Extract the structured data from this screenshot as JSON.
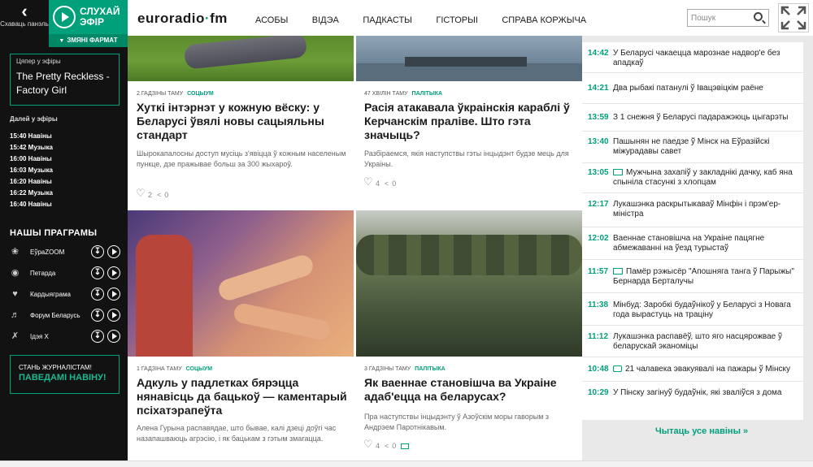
{
  "sidebar": {
    "collapse_label": "Схаваць панэль",
    "listen_label": "СЛУХАЙ ЭФІР",
    "change_format": "ЗМЯНІ ФАРМАТ",
    "now_label": "Цяпер у эфіры",
    "now_track": "The Pretty Reckless - Factory Girl",
    "next_label": "Далей у эфіры",
    "schedule": [
      "15:40 Навіны",
      "15:42 Музыка",
      "16:00 Навіны",
      "16:03 Музыка",
      "16:20 Навіны",
      "16:22 Музыка",
      "16:40 Навіны"
    ],
    "programs_title": "НАШЫ ПРАГРАМЫ",
    "programs": [
      {
        "name": "ЕўраZOOM",
        "icon": "globe-icon"
      },
      {
        "name": "Петарда",
        "icon": "circle-icon"
      },
      {
        "name": "Кардыяграма",
        "icon": "heart-icon"
      },
      {
        "name": "Форум Беларусь",
        "icon": "speaker-icon"
      },
      {
        "name": "Ідэя Х",
        "icon": "tools-icon"
      }
    ],
    "cta_line1": "СТАНЬ ЖУРНАЛІСТАМ!",
    "cta_line2": "ПАВЕДАМІ НАВІНУ!"
  },
  "header": {
    "logo_part1": "euroradio",
    "logo_part2": "fm",
    "nav": [
      "АСОБЫ",
      "ВІДЭА",
      "ПАДКАСТЫ",
      "ГІСТОРЫІ",
      "СПРАВА КОРЖЫЧА"
    ],
    "search_placeholder": "Пошук"
  },
  "articles": [
    {
      "time": "2 ГАДЗІНЫ ТАМУ",
      "category": "СОЦЫУМ",
      "title": "Хуткі інтэрнэт у кожную вёску: у Беларусі ўвялі новы сацыяльны стандарт",
      "lead": "Шырокапалосны доступ мусіць з'явіцца ў кожным населеным пункце, дзе пражывае больш за 300 жыхароў.",
      "likes": "2",
      "shares": "0"
    },
    {
      "time": "47 ХВІЛІН ТАМУ",
      "category": "ПАЛІТЫКА",
      "title": "Расія атакавала ўкраінскія караблі ў Керчанскім праліве. Што гэта значыць?",
      "lead": "Разбіраемся, якія наступствы гэты інцыдэнт будзе мець для Украіны.",
      "likes": "4",
      "shares": "0"
    },
    {
      "time": "1 ГАДЗІНА ТАМУ",
      "category": "СОЦЫУМ",
      "title": "Адкуль у падлетках бярэцца нянавісць да бацькоў — каментарый псіхатэрапеўта",
      "lead": "Алена Гурына распавядае, што бывае, калі дзеці доўгі час назапашваюць агрэсію, і як бацькам з гэтым змагацца.",
      "likes": "",
      "shares": ""
    },
    {
      "time": "3 ГАДЗІНЫ ТАМУ",
      "category": "ПАЛІТЫКА",
      "title": "Як ваеннае становішча ва Украіне адаб'ецца на беларусах?",
      "lead": "Пра наступствы інцыдэнту ў Азоўскім моры гаворым з Андрэем Паротнікавым.",
      "likes": "4",
      "shares": "0"
    }
  ],
  "feed": [
    {
      "time": "14:42",
      "text": "У Беларусі чакаецца марознае надвор'е без ападкаў",
      "icon": ""
    },
    {
      "time": "14:21",
      "text": "Два рыбакі патанулі ў Івацэвіцкім раёне",
      "icon": ""
    },
    {
      "time": "13:59",
      "text": "З 1 снежня ў Беларусі падаражэюць цыгарэты",
      "icon": ""
    },
    {
      "time": "13:40",
      "text": "Пашынян не паедзе ў Мінск на Еўразійскі міжурадавы савет",
      "icon": ""
    },
    {
      "time": "13:05",
      "text": "Мужчына захапіў у закладнікі дачку, каб яна спыніла стасункі з хлопцам",
      "icon": "video"
    },
    {
      "time": "12:17",
      "text": "Лукашэнка раскрытыкаваў Мінфін і прэм'ер-міністра",
      "icon": ""
    },
    {
      "time": "12:02",
      "text": "Ваеннае становішча на Украіне пацягне абмежаванні на ўезд турыстаў",
      "icon": ""
    },
    {
      "time": "11:57",
      "text": "Памёр рэжысёр \"Апошняга танга ў Парыжы\" Бернарда Берталучы",
      "icon": "video"
    },
    {
      "time": "11:38",
      "text": "Мінбуд: Заробкі будаўнікоў у Беларусі з Новага года вырастуць на трацiну",
      "icon": ""
    },
    {
      "time": "11:12",
      "text": "Лукашэнка распавёў, што яго насцярожвае ў беларускай эканоміцы",
      "icon": ""
    },
    {
      "time": "10:48",
      "text": "21 чалавека эвакуявалі на пажары ў Мінску",
      "icon": "photo"
    },
    {
      "time": "10:29",
      "text": "У Пінску загінуў будаўнік, які зваліўся з дома",
      "icon": ""
    }
  ],
  "all_news_label": "Чытаць усе навіны »"
}
